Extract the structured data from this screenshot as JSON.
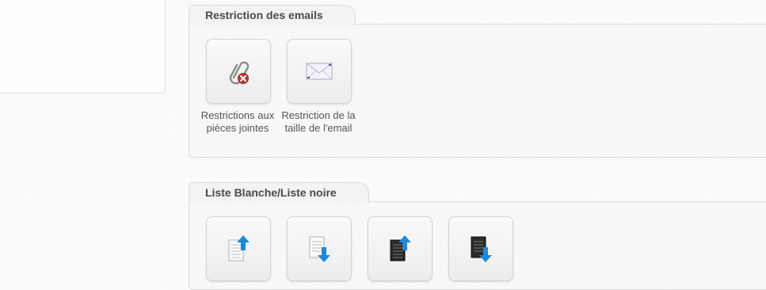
{
  "groups": {
    "email_restriction": {
      "title": "Restriction des emails",
      "items": [
        {
          "label": "Restrictions aux pièces jointes",
          "icon": "paperclip-remove-icon"
        },
        {
          "label": "Restriction de la taille de l'email",
          "icon": "envelope-icon"
        }
      ]
    },
    "whitelist_blacklist": {
      "title": "Liste Blanche/Liste noire",
      "items": [
        {
          "icon": "whitelist-import-icon"
        },
        {
          "icon": "whitelist-export-icon"
        },
        {
          "icon": "blacklist-import-icon"
        },
        {
          "icon": "blacklist-export-icon"
        }
      ]
    }
  },
  "colors": {
    "arrow_blue": "#1e88d6",
    "remove_red": "#c0392b",
    "title_text": "#4a4a4a"
  }
}
